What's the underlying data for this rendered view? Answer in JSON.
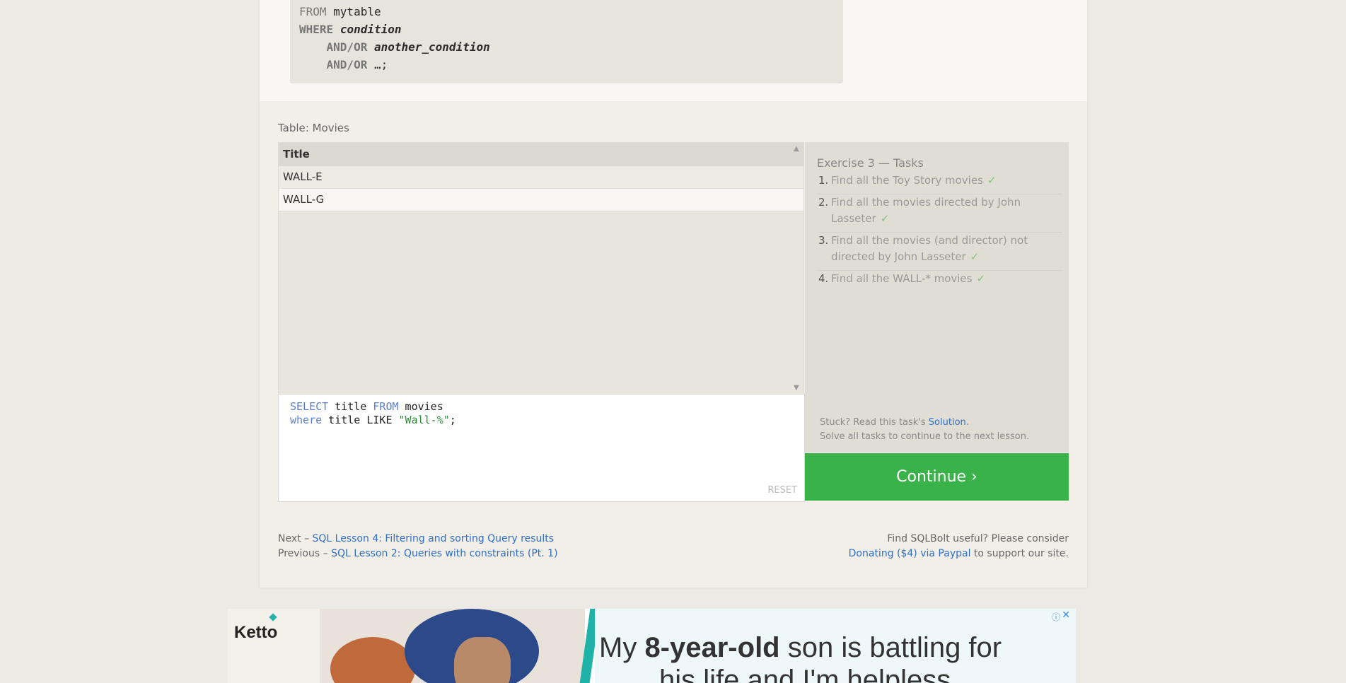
{
  "code_example": {
    "lines": [
      {
        "kw": "FROM",
        "rest": " mytable"
      },
      {
        "kw": "WHERE",
        "rest": " ",
        "emph": "condition"
      },
      {
        "indent": "    ",
        "kw": "AND/OR",
        "rest": " ",
        "emph": "another_condition"
      },
      {
        "indent": "    ",
        "kw": "AND/OR",
        "rest": " …;"
      }
    ]
  },
  "table": {
    "caption": "Table: Movies",
    "header": "Title",
    "rows": [
      "WALL-E",
      "WALL-G"
    ]
  },
  "editor": {
    "line1": {
      "kw1": "SELECT",
      "t1": " title ",
      "kw2": "FROM",
      "t2": " movies"
    },
    "line2": {
      "kw1": "where",
      "t1": " title LIKE ",
      "str": "\"Wall-%\"",
      "t2": ";"
    },
    "reset_label": "RESET"
  },
  "tasks": {
    "title": "Exercise 3 — Tasks",
    "items": [
      {
        "num": "1.",
        "text": "Find all the Toy Story movies",
        "check": "✓"
      },
      {
        "num": "2.",
        "text": "Find all the movies directed by John Lasseter",
        "check": "✓"
      },
      {
        "num": "3.",
        "text": "Find all the movies (and director) not directed by John Lasseter",
        "check": "✓"
      },
      {
        "num": "4.",
        "text": "Find all the WALL-* movies",
        "check": "✓"
      }
    ],
    "stuck_prefix": "Stuck? Read this task's ",
    "solution_link": "Solution",
    "stuck_suffix": ".",
    "solve_all": "Solve all tasks to continue to the next lesson."
  },
  "continue_label": "Continue ›",
  "footer": {
    "next_prefix": "Next – ",
    "next_link": "SQL Lesson 4: Filtering and sorting Query results",
    "prev_prefix": "Previous – ",
    "prev_link": "SQL Lesson 2: Queries with constraints (Pt. 1)",
    "useful": "Find SQLBolt useful? Please consider",
    "donate_link": "Donating ($4) via Paypal",
    "donate_suffix": " to support our site."
  },
  "ad": {
    "logo": "Ketto",
    "text_pre": "My ",
    "text_bold": "8-year-old",
    "text_post": " son is battling for",
    "text_line2": "his life and I'm helpless",
    "info_icon": "ⓘ",
    "close_icon": "✕"
  },
  "colors": {
    "continue": "#3ab24a",
    "link": "#2f6fc8",
    "check": "#7fc47f",
    "sql_keyword": "#5b7fcf",
    "sql_string": "#2e8b3a"
  }
}
